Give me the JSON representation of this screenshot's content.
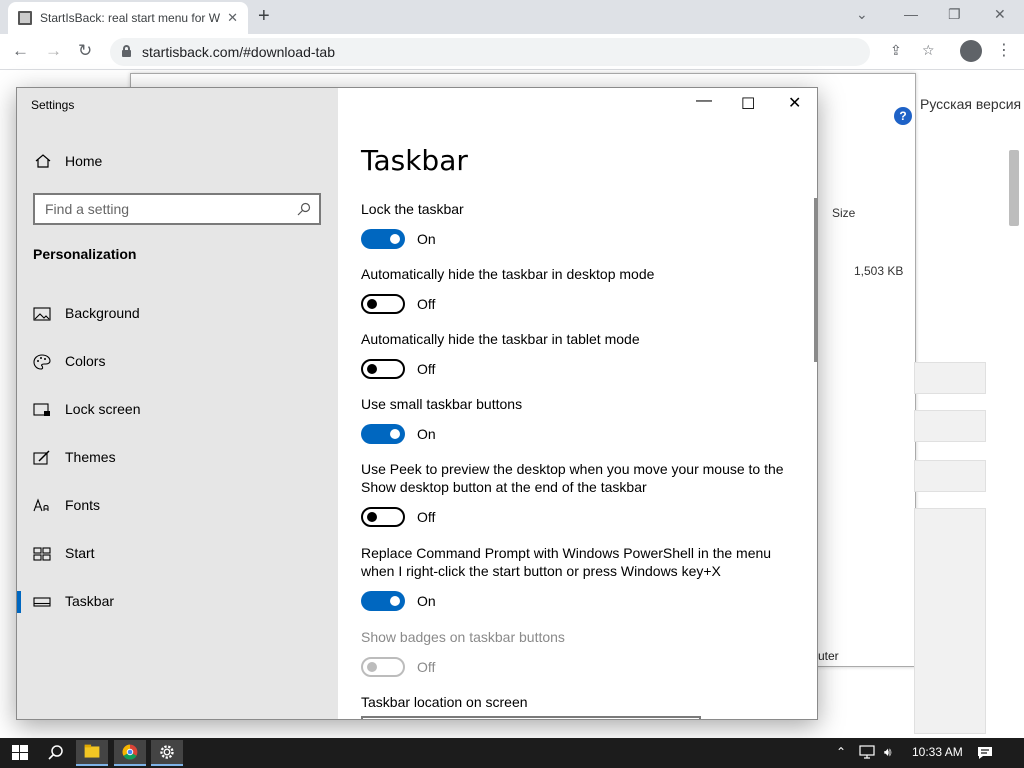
{
  "browser": {
    "tab_title": "StartIsBack: real start menu for W",
    "url": "startisback.com/#download-tab"
  },
  "webpage": {
    "language_link": "Русская версия"
  },
  "explorer": {
    "size_header": "Size",
    "file_size": "1,503 KB",
    "status_computer": "uter"
  },
  "settings": {
    "window_title": "Settings",
    "home_label": "Home",
    "search_placeholder": "Find a setting",
    "section_heading": "Personalization",
    "nav_items": [
      {
        "label": "Background",
        "icon": "image-icon"
      },
      {
        "label": "Colors",
        "icon": "palette-icon"
      },
      {
        "label": "Lock screen",
        "icon": "lock-screen-icon"
      },
      {
        "label": "Themes",
        "icon": "brush-icon"
      },
      {
        "label": "Fonts",
        "icon": "font-icon"
      },
      {
        "label": "Start",
        "icon": "start-tiles-icon"
      },
      {
        "label": "Taskbar",
        "icon": "taskbar-icon",
        "selected": true
      }
    ],
    "page_heading": "Taskbar",
    "options": [
      {
        "label": "Lock the taskbar",
        "state": "On",
        "on": true,
        "enabled": true
      },
      {
        "label": "Automatically hide the taskbar in desktop mode",
        "state": "Off",
        "on": false,
        "enabled": true
      },
      {
        "label": "Automatically hide the taskbar in tablet mode",
        "state": "Off",
        "on": false,
        "enabled": true
      },
      {
        "label": "Use small taskbar buttons",
        "state": "On",
        "on": true,
        "enabled": true
      },
      {
        "label": "Use Peek to preview the desktop when you move your mouse to the Show desktop button at the end of the taskbar",
        "state": "Off",
        "on": false,
        "enabled": true
      },
      {
        "label": "Replace Command Prompt with Windows PowerShell in the menu when I right-click the start button or press Windows key+X",
        "state": "On",
        "on": true,
        "enabled": true
      },
      {
        "label": "Show badges on taskbar buttons",
        "state": "Off",
        "on": false,
        "enabled": false
      }
    ],
    "location_label": "Taskbar location on screen"
  },
  "taskbar": {
    "clock": "10:33 AM"
  },
  "colors": {
    "accent": "#0067c0",
    "taskbar_bg": "#1c1c1c",
    "sidebar_bg": "#e6e6e6"
  }
}
